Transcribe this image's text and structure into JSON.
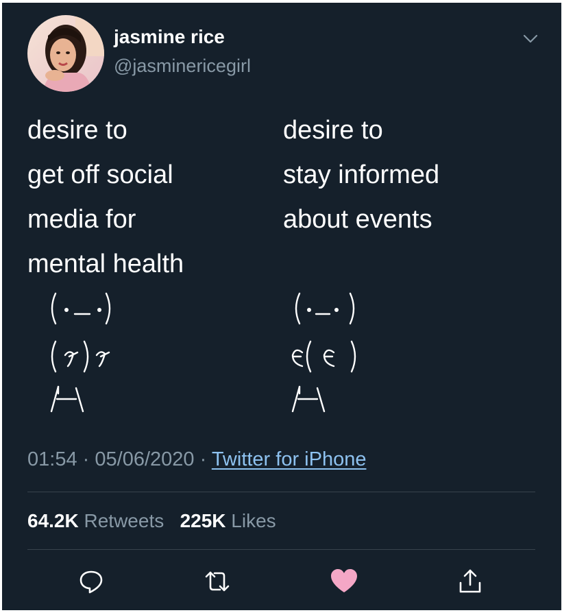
{
  "tweet": {
    "author_name": "jasmine rice",
    "author_handle": "@jasminericegirl",
    "left_column": {
      "lines": [
        "desire to",
        "get off social",
        "media for",
        "mental health"
      ],
      "face": "(•_•)",
      "arms": "(ง )ง",
      "legs": "/\\"
    },
    "right_column": {
      "lines": [
        "desire to",
        "stay informed",
        "about events"
      ],
      "face": "(•_• )",
      "arms": "ε( ε )",
      "legs": "/\\"
    },
    "time": "01:54",
    "separator": "·",
    "date": "05/06/2020",
    "source": "Twitter for iPhone",
    "retweets_count": "64.2K",
    "retweets_label": "Retweets",
    "likes_count": "225K",
    "likes_label": "Likes"
  },
  "actions": [
    {
      "name": "reply",
      "icon": "speech-bubble-icon"
    },
    {
      "name": "retweet",
      "icon": "retweet-icon"
    },
    {
      "name": "like",
      "icon": "heart-icon",
      "color": "#e0245e"
    },
    {
      "name": "share",
      "icon": "share-icon"
    }
  ],
  "colors": {
    "background": "#15202b",
    "secondary_text": "#8899a6",
    "link": "#8ec2f0",
    "like": "#f4a7c6"
  }
}
